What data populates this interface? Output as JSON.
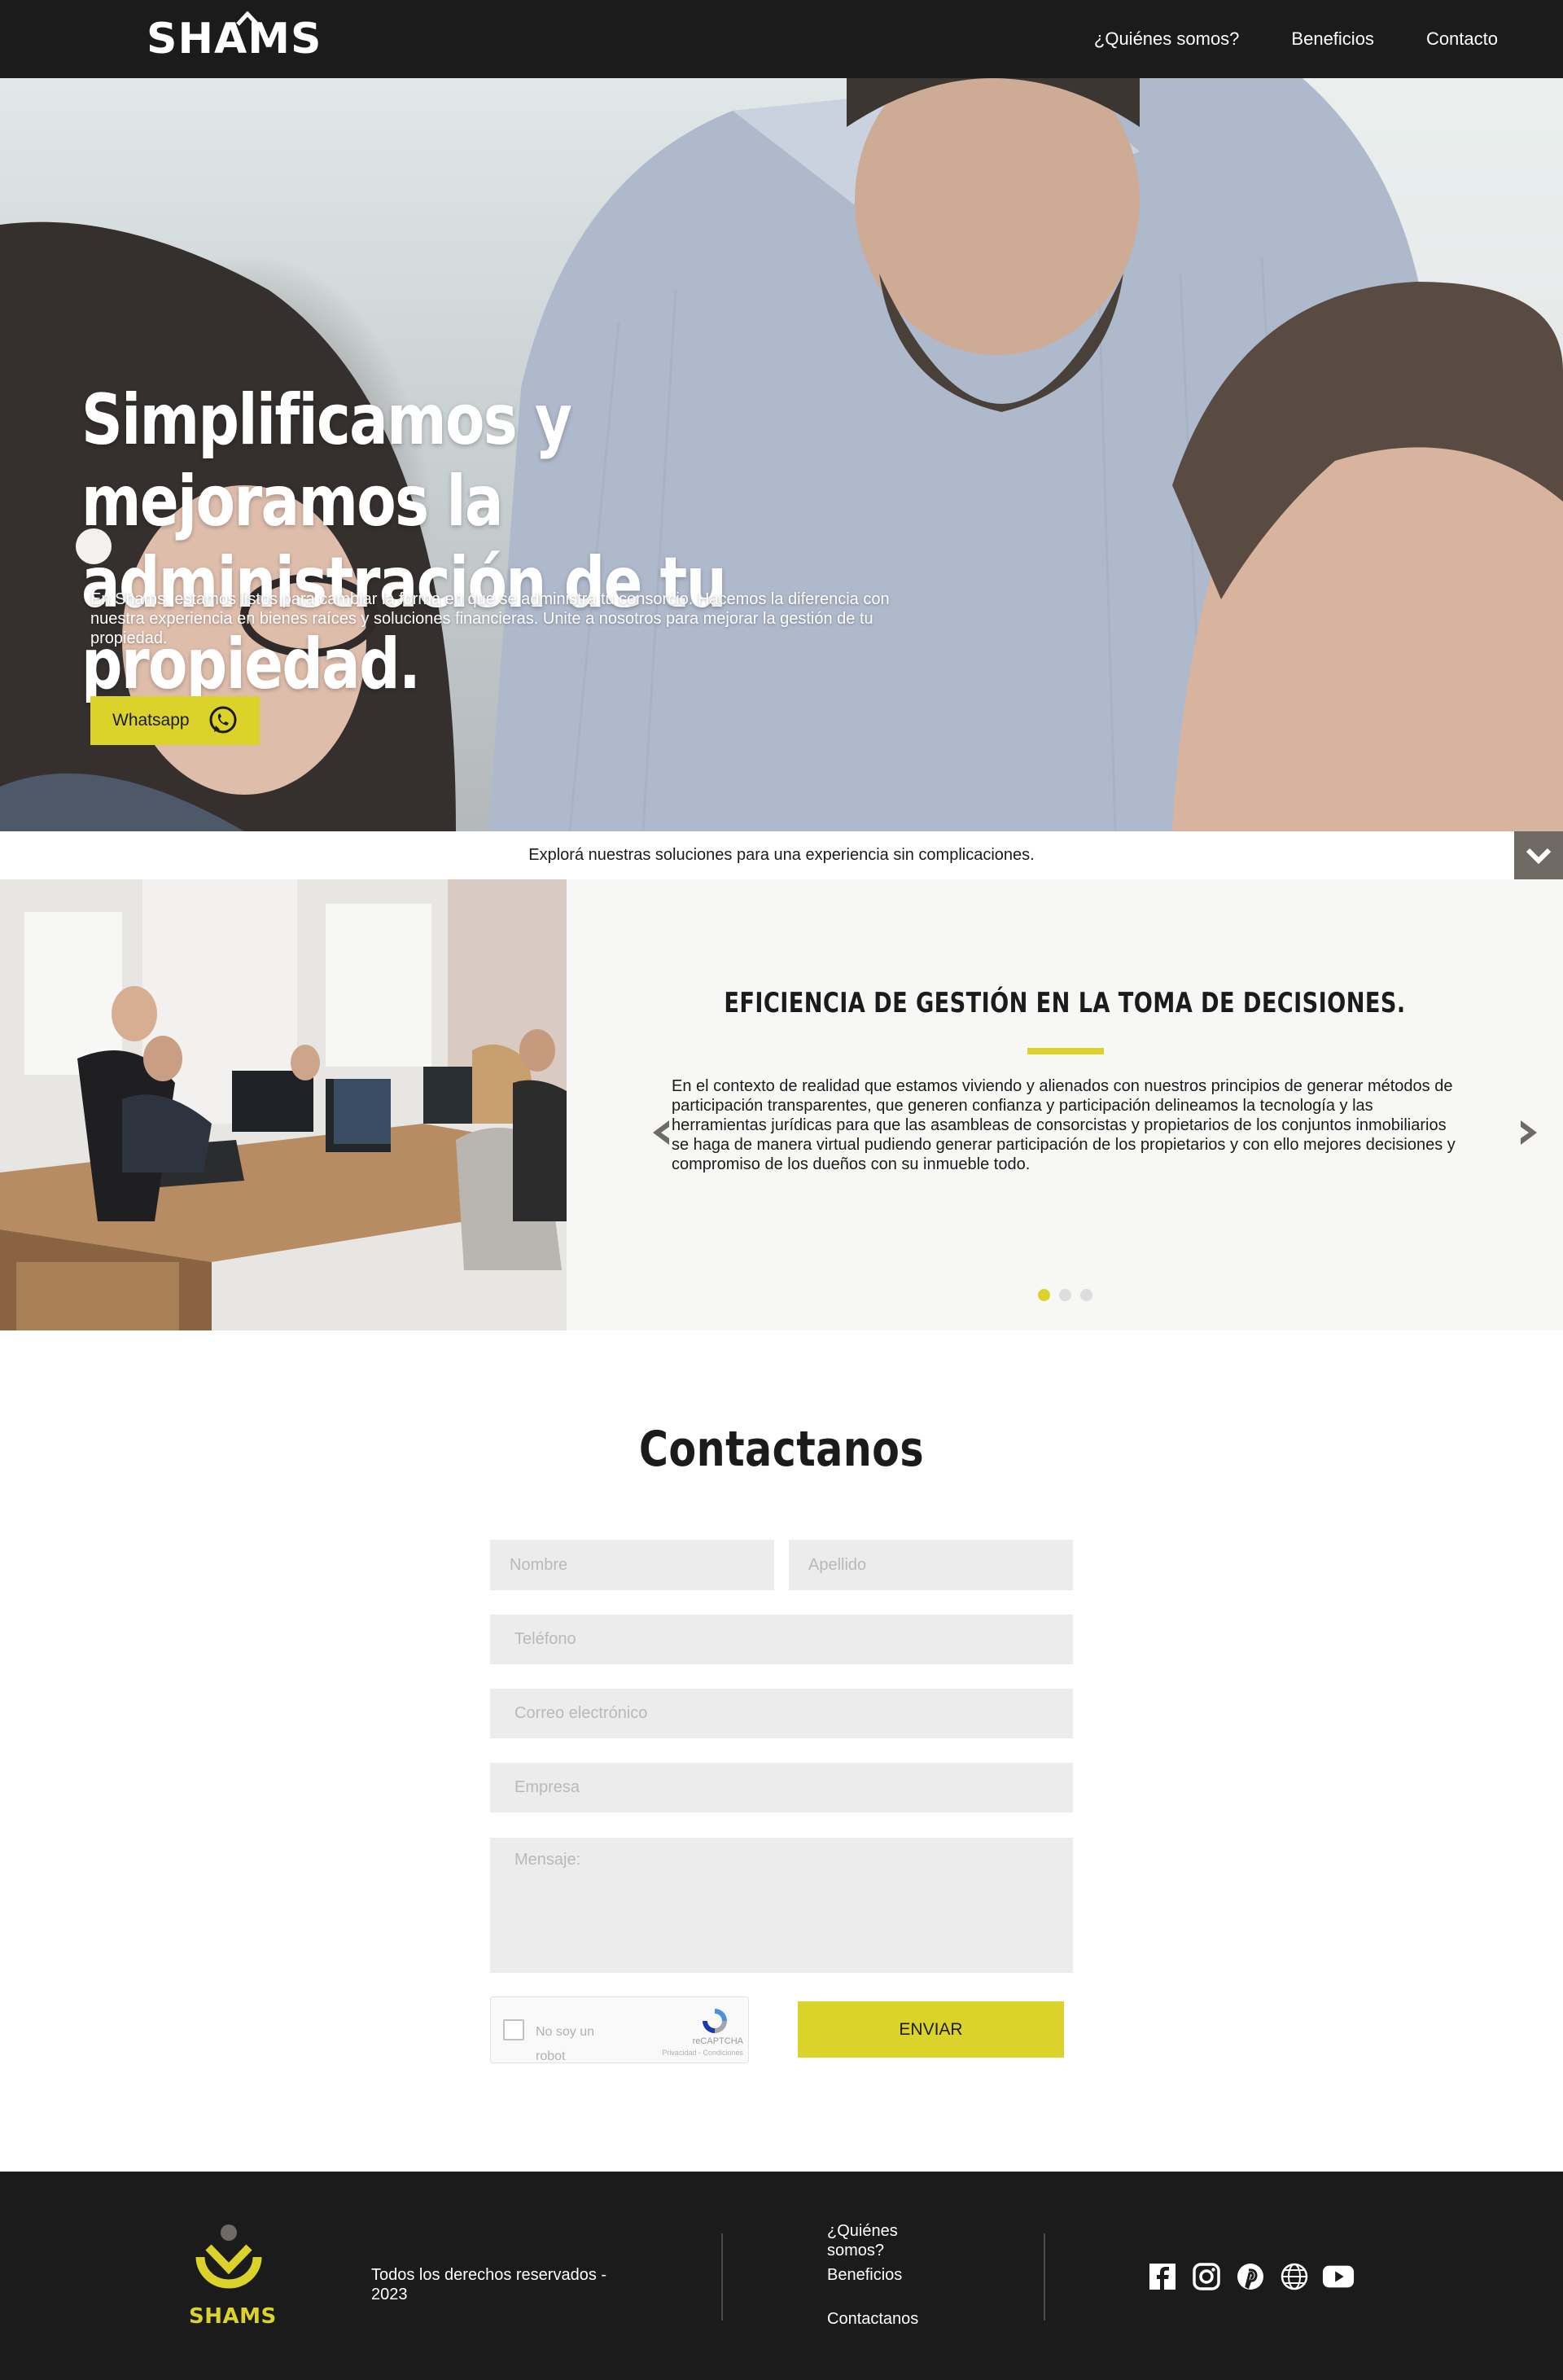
{
  "header": {
    "logo": "SHAMS",
    "nav": [
      {
        "label": "¿Quiénes somos?"
      },
      {
        "label": "Beneficios"
      },
      {
        "label": "Contacto"
      }
    ]
  },
  "hero": {
    "title": "Simplificamos y mejoramos la administración de tu propiedad.",
    "subtitle": "En Shams, estamos listos para cambiar la forma en que se administra tu consorcio. Hacemos la diferencia con nuestra experiencia en bienes raíces y soluciones financieras. Unite a nosotros para mejorar la gestión de tu propiedad.",
    "cta_label": "Whatsapp",
    "cta_icon": "whatsapp-icon"
  },
  "strip": {
    "text": "Explorá nuestras soluciones para una experiencia sin complicaciones.",
    "scroll_icon": "chevron-down-icon"
  },
  "slider": {
    "title": "EFICIENCIA DE GESTIÓN EN LA TOMA DE DECISIONES.",
    "text": "En el contexto de realidad que estamos viviendo y alienados con nuestros principios de generar métodos de participación transparentes, que generen confianza y participación delineamos la tecnología y las herramientas jurídicas para que las asambleas de consorcistas y propietarios de los conjuntos inmobiliarios se haga de manera virtual pudiendo generar participación de los propietarios y con ello mejores decisiones y compromiso de los dueños con su inmueble todo.",
    "slide_count": 3,
    "active_slide": 1
  },
  "contact": {
    "title": "Contactanos",
    "fields": {
      "first_name": "Nombre",
      "last_name": "Apellido",
      "phone": "Teléfono",
      "email": "Correo electrónico",
      "company": "Empresa",
      "message": "Mensaje:"
    },
    "captcha": {
      "label": "No soy un robot",
      "brand": "reCAPTCHA",
      "links": "Privacidad - Condiciones"
    },
    "submit_label": "ENVIAR"
  },
  "footer": {
    "logo_text": "SHAMS",
    "copyright": "Todos los derechos reservados - 2023",
    "links": [
      {
        "label": "¿Quiénes somos?"
      },
      {
        "label": "Beneficios"
      },
      {
        "label": "Contactanos"
      }
    ],
    "socials": [
      "facebook-icon",
      "instagram-icon",
      "pinterest-icon",
      "globe-icon",
      "youtube-icon"
    ]
  },
  "colors": {
    "accent": "#dbd32a",
    "dark": "#1b1b1b",
    "field_bg": "#ececec",
    "scroll_button": "#6f6a64"
  }
}
